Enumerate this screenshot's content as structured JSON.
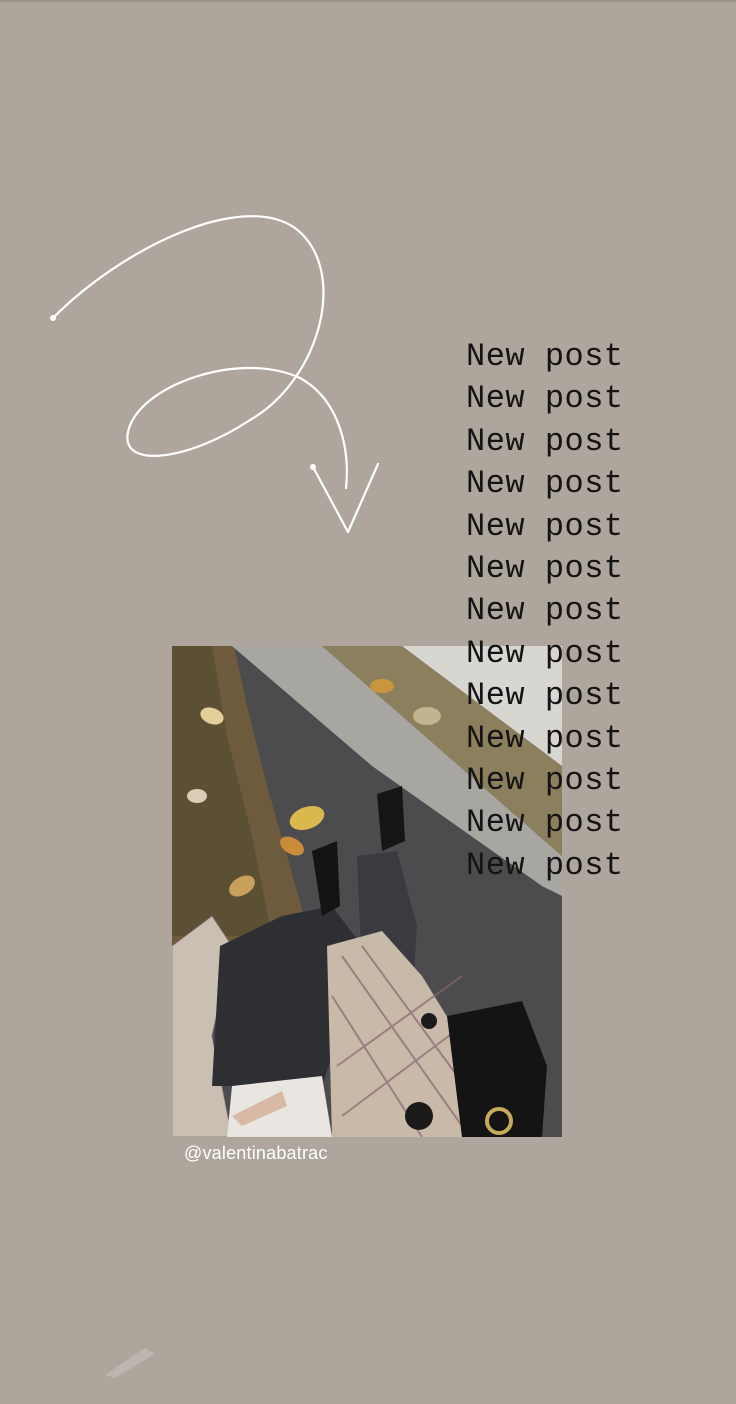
{
  "story": {
    "repeat_lines": [
      "New post",
      "New post",
      "New post",
      "New post",
      "New post",
      "New post",
      "New post",
      "New post",
      "New post",
      "New post",
      "New post",
      "New post",
      "New post"
    ],
    "credit": "@valentinabatrac",
    "background_color": "#aea69d",
    "text_color": "#141414",
    "doodle_color": "#ffffff"
  }
}
